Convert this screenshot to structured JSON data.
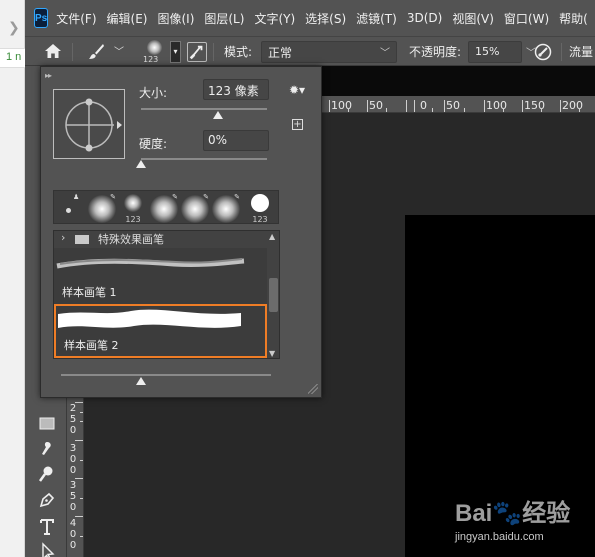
{
  "app": {
    "logo": "Ps",
    "menu": [
      "文件(F)",
      "编辑(E)",
      "图像(I)",
      "图层(L)",
      "文字(Y)",
      "选择(S)",
      "滤镜(T)",
      "3D(D)",
      "视图(V)",
      "窗口(W)",
      "帮助("
    ]
  },
  "outer": {
    "tab_fragment": "1 n"
  },
  "options": {
    "brush_size": "123",
    "mode_label": "模式:",
    "mode_value": "正常",
    "opacity_label": "不透明度:",
    "opacity_value": "15%",
    "flow_label": "流量"
  },
  "brush_panel": {
    "size_label": "大小:",
    "size_value": "123 像素",
    "hardness_label": "硬度:",
    "hardness_value": "0%",
    "size_slider_fraction": 0.61,
    "hardness_slider_fraction": 0.0,
    "recent_caps": [
      "123",
      "123"
    ],
    "group_name": "特殊效果画笔",
    "items": [
      {
        "name": "样本画笔 1"
      },
      {
        "name": "样本画笔 2"
      }
    ],
    "bottom_slider_fraction": 0.38
  },
  "ruler_h": [
    "100",
    "50",
    "0",
    "50",
    "100",
    "150",
    "200"
  ],
  "ruler_v": [
    [
      "2",
      "5",
      "0"
    ],
    [
      "3",
      "0",
      "0"
    ],
    [
      "3",
      "5",
      "0"
    ],
    [
      "4",
      "0",
      "0"
    ]
  ],
  "watermark": {
    "logo_prefix": "Bai",
    "logo_suffix": "经验",
    "url": "jingyan.baidu.com"
  },
  "colors": {
    "accent_selection": "#ef7d26",
    "ps_blue": "#31a8ff",
    "ui_gray": "#535353"
  },
  "icons": {
    "home": "home-icon",
    "brush": "brush-icon",
    "brush_settings": "brush-settings-icon",
    "pressure": "pressure-icon",
    "gear": "gear-icon",
    "new_preset": "new-preset-icon",
    "folder": "folder-icon"
  }
}
